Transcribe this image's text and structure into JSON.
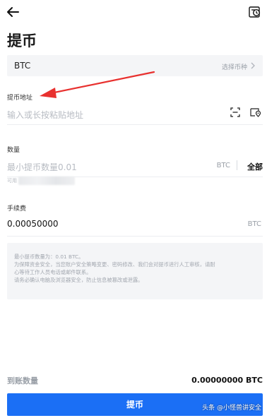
{
  "page": {
    "title": "提币"
  },
  "coin": {
    "value": "BTC",
    "hint": "选择币种"
  },
  "address": {
    "label": "提币地址",
    "placeholder": "输入或长按粘贴地址"
  },
  "amount": {
    "label": "数量",
    "placeholder": "最小提币数量0.01",
    "unit": "BTC",
    "all_label": "全部",
    "available_label": "可用"
  },
  "fee": {
    "label": "手续费",
    "value": "0.00050000",
    "unit": "BTC"
  },
  "notice": {
    "lines": [
      "最小提币数量为：0.01 BTC。",
      "为保障资金安全，当您账户安全策略变更、密码修改、我们会对提币进行人工审核，请耐",
      "心等待工作人员电话或邮件联系。",
      "请务必确认电脑及浏览器安全，防止信息被篡改或泄露。"
    ]
  },
  "receive": {
    "label": "到账数量",
    "value": "0.00000000 BTC"
  },
  "submit": {
    "label": "提币"
  },
  "watermark": {
    "text": "头条 @小怪兽讲安全"
  },
  "colors": {
    "accent": "#1b6ff5",
    "annotation": "#e8312f",
    "muted": "#9aa0a8"
  },
  "icons": {
    "back": "back-arrow-icon",
    "history": "history-icon",
    "scan": "scan-icon",
    "address_book": "address-book-icon",
    "chevron": "chevron-right-icon"
  }
}
